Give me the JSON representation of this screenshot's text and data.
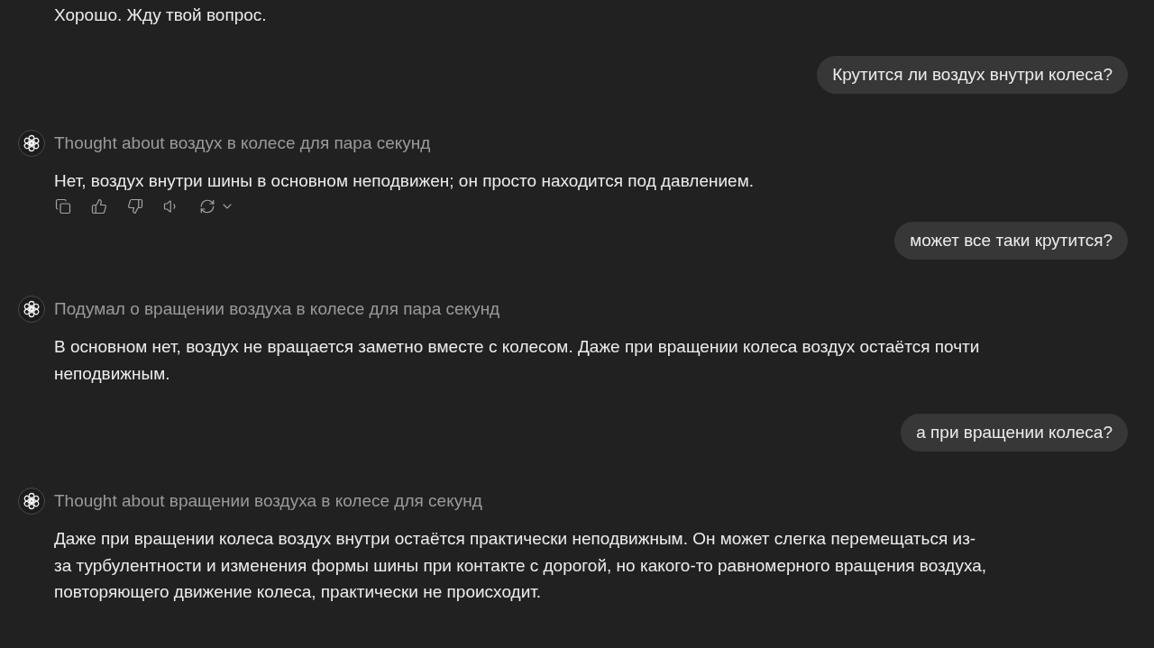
{
  "messages": [
    {
      "kind": "assistant",
      "lines": [
        "Хорошо. Жду твой вопрос."
      ],
      "actions_shown": false
    },
    {
      "kind": "user",
      "text": "Крутится ли воздух внутри колеса?"
    },
    {
      "kind": "assistant",
      "thought": "Thought about воздух в колесе для пара секунд",
      "lines": [
        "Нет, воздух внутри шины в основном неподвижен; он просто находится под давлением."
      ],
      "actions_shown": true
    },
    {
      "kind": "user",
      "text": "может все таки крутится?"
    },
    {
      "kind": "assistant",
      "thought": "Подумал о вращении воздуха в колесе для пара секунд",
      "lines": [
        "В основном нет, воздух не вращается заметно вместе с колесом. Даже при вращении колеса воздух остаётся почти",
        "неподвижным."
      ],
      "actions_shown": false
    },
    {
      "kind": "user",
      "text": "а при вращении колеса?"
    },
    {
      "kind": "assistant",
      "thought": "Thought about вращении воздуха в колесе для секунд",
      "lines": [
        "Даже при вращении колеса воздух внутри остаётся практически неподвижным. Он может слегка перемещаться из-",
        "за турбулентности и изменения формы шины при контакте с дорогой, но какого-то равномерного вращения воздуха,",
        "повторяющего движение колеса, практически не происходит."
      ],
      "actions_shown": false
    }
  ]
}
